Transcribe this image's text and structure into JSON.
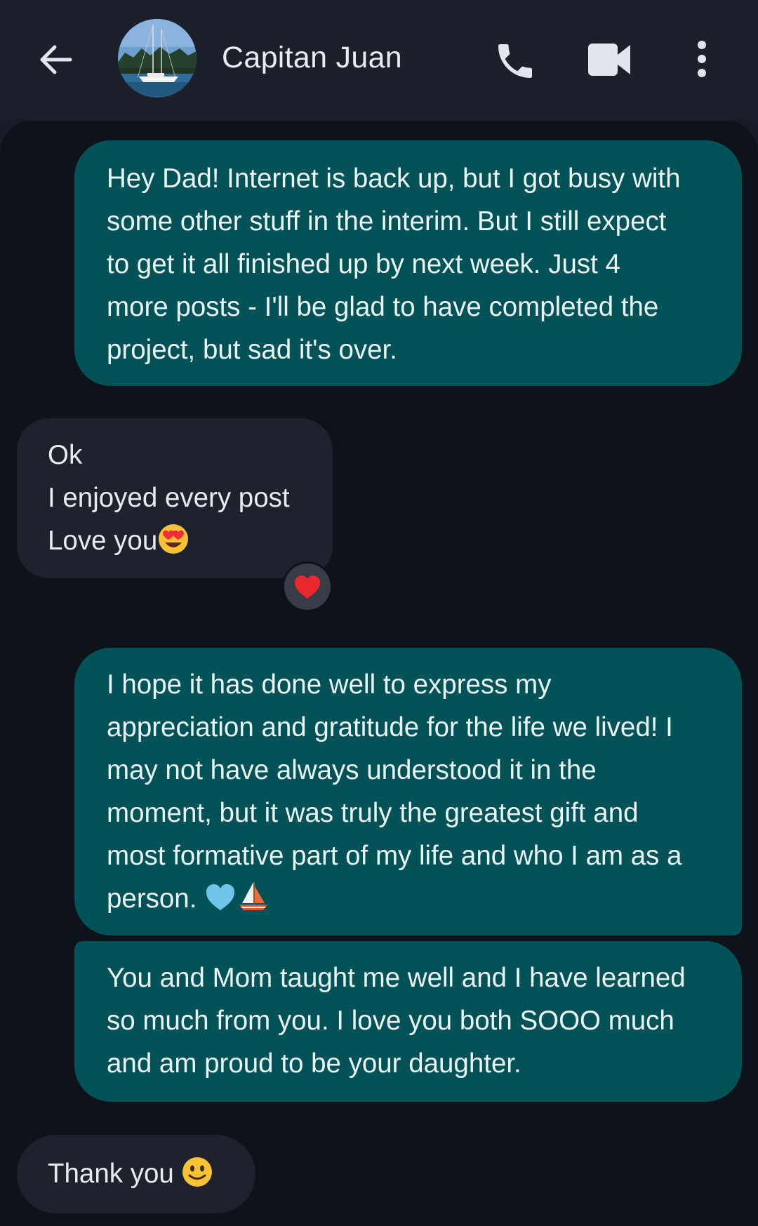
{
  "header": {
    "contact_name": "Capitan Juan",
    "icons": {
      "back": "arrow-left-icon",
      "call": "phone-icon",
      "video": "video-camera-icon",
      "menu": "more-vertical-icon"
    }
  },
  "messages": [
    {
      "direction": "outgoing",
      "lines": [
        "Hey Dad! Internet is back up, but I got busy with",
        "some other stuff in the interim. But I still expect",
        "to get it all finished up by next week. Just 4",
        "more posts - I'll be glad to have completed the",
        "project, but sad it's over."
      ]
    },
    {
      "direction": "incoming",
      "lines": [
        "Ok",
        "I enjoyed every post",
        "Love you"
      ],
      "emoji": "heart-eyes-emoji",
      "reaction": "red-heart-emoji"
    },
    {
      "direction": "outgoing",
      "lines": [
        "I hope it has done well to express my",
        "appreciation and gratitude for the life we lived! I",
        "may not have always understood it in the",
        "moment, but it was truly the greatest gift and",
        "most formative part of my life and who I am as a",
        "person."
      ],
      "emojis": [
        "light-blue-heart-emoji",
        "sailboat-emoji"
      ]
    },
    {
      "direction": "outgoing",
      "lines": [
        "You and Mom taught me well and I have learned",
        "so much from you. I love you both SOOO much",
        "and am proud to be your daughter."
      ]
    },
    {
      "direction": "incoming",
      "lines": [
        "Thank you"
      ],
      "emoji": "slightly-smiling-face-emoji"
    }
  ],
  "colors": {
    "header_bg": "#1b202b",
    "thread_bg": "#0d121b",
    "outgoing_bubble": "#035257",
    "incoming_bubble": "#1d222c"
  }
}
